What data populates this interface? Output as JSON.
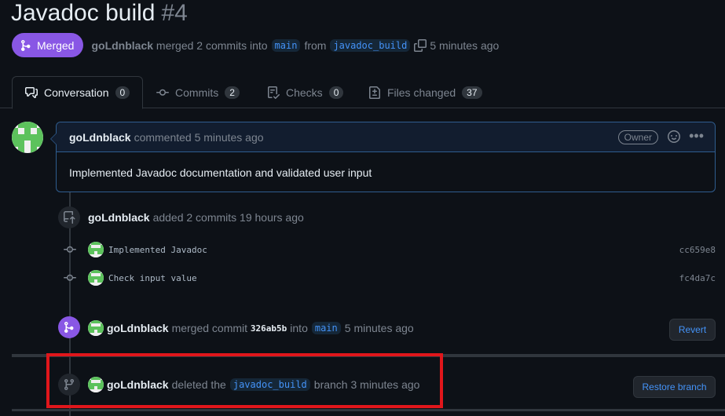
{
  "pr": {
    "title": "Javadoc build",
    "number": "#4",
    "state": "Merged",
    "author": "goLdnblack",
    "merge_text": "merged 2 commits into",
    "base_branch": "main",
    "from_text": "from",
    "head_branch": "javadoc_build",
    "time": "5 minutes ago"
  },
  "tabs": [
    {
      "label": "Conversation",
      "count": "0",
      "icon": "comment-discussion-icon"
    },
    {
      "label": "Commits",
      "count": "2",
      "icon": "git-commit-icon"
    },
    {
      "label": "Checks",
      "count": "0",
      "icon": "checklist-icon"
    },
    {
      "label": "Files changed",
      "count": "37",
      "icon": "file-diff-icon"
    }
  ],
  "comment": {
    "author": "goLdnblack",
    "action": "commented 5 minutes ago",
    "badge": "Owner",
    "body": "Implemented Javadoc documentation and validated user input"
  },
  "commits_event": {
    "author": "goLdnblack",
    "text": "added 2 commits 19 hours ago",
    "commits": [
      {
        "message": "Implemented Javadoc",
        "sha": "cc659e8"
      },
      {
        "message": "Check input value",
        "sha": "fc4da7c"
      }
    ]
  },
  "merge_event": {
    "author": "goLdnblack",
    "text1": "merged commit",
    "sha": "326ab5b",
    "text2": "into",
    "branch": "main",
    "time": "5 minutes ago",
    "button": "Revert"
  },
  "delete_event": {
    "author": "goLdnblack",
    "text1": "deleted the",
    "branch": "javadoc_build",
    "text2": "branch 3 minutes ago",
    "button": "Restore branch"
  },
  "colors": {
    "merged_purple": "#8957e5",
    "link_blue": "#4493f8",
    "highlight_red": "#e0161b"
  }
}
